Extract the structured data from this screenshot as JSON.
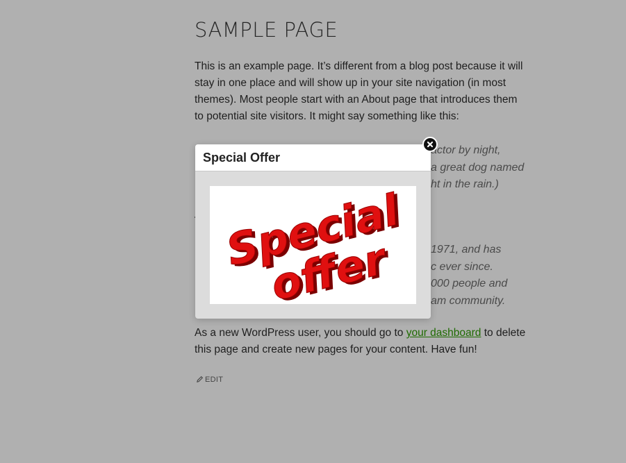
{
  "page": {
    "title": "SAMPLE PAGE",
    "intro": "This is an example page. It’s different from a blog post because it will stay in one place and will show up in your site navigation (in most themes). Most people start with an About page that introduces them to potential site visitors. It might say something like this:",
    "quote1_fragments": [
      "actor by night,",
      "a great dog named",
      "ht in the rain.)"
    ],
    "quote2_fragments": [
      "1971, and has",
      "c ever since.",
      "000 people and",
      "am community."
    ],
    "outro_before": "As a new WordPress user, you should go to ",
    "outro_link": "your dashboard",
    "outro_after": " to delete this page and create new pages for your content. Have fun!",
    "edit_label": "EDIT"
  },
  "modal": {
    "title": "Special Offer",
    "image_text_line1": "Special",
    "image_text_line2": "offer"
  },
  "colors": {
    "overlay_bg": "#b0b0b0",
    "link": "#1e6b00",
    "offer_red": "#e01010"
  }
}
